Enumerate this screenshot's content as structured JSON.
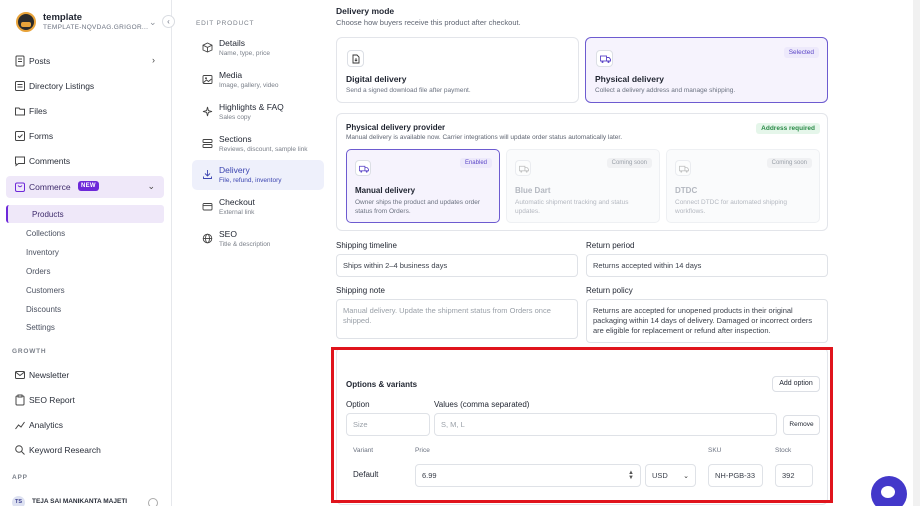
{
  "workspace": {
    "name": "template",
    "subtitle": "TEMPLATE-NQVDAG.GRIGOR..."
  },
  "sidebar": {
    "items": [
      {
        "label": "Posts"
      },
      {
        "label": "Directory Listings"
      },
      {
        "label": "Files"
      },
      {
        "label": "Forms"
      },
      {
        "label": "Comments"
      },
      {
        "label": "Commerce",
        "badge": "NEW"
      }
    ],
    "commerce_sub": [
      "Products",
      "Collections",
      "Inventory",
      "Orders",
      "Customers",
      "Discounts",
      "Settings"
    ],
    "growth_label": "GROWTH",
    "growth_items": [
      {
        "label": "Newsletter"
      },
      {
        "label": "SEO Report"
      },
      {
        "label": "Analytics"
      },
      {
        "label": "Keyword Research"
      }
    ],
    "app_label": "APP",
    "user": {
      "initials": "TS",
      "name": "TEJA SAI MANIKANTA MAJETI"
    }
  },
  "edit_product": {
    "heading": "EDIT PRODUCT",
    "items": [
      {
        "title": "Details",
        "sub": "Name, type, price"
      },
      {
        "title": "Media",
        "sub": "Image, gallery, video"
      },
      {
        "title": "Highlights & FAQ",
        "sub": "Sales copy"
      },
      {
        "title": "Sections",
        "sub": "Reviews, discount, sample link"
      },
      {
        "title": "Delivery",
        "sub": "File, refund, inventory"
      },
      {
        "title": "Checkout",
        "sub": "External link"
      },
      {
        "title": "SEO",
        "sub": "Title & description"
      }
    ]
  },
  "delivery": {
    "title": "Delivery mode",
    "subtitle": "Choose how buyers receive this product after checkout.",
    "digital": {
      "title": "Digital delivery",
      "sub": "Send a signed download file after payment."
    },
    "physical": {
      "title": "Physical delivery",
      "sub": "Collect a delivery address and manage shipping.",
      "tag": "Selected"
    },
    "provider": {
      "title": "Physical delivery provider",
      "sub": "Manual delivery is available now. Carrier integrations will update order status automatically later.",
      "tag": "Address required",
      "options": [
        {
          "name": "Manual delivery",
          "desc": "Owner ships the product and updates order status from Orders.",
          "tag": "Enabled"
        },
        {
          "name": "Blue Dart",
          "desc": "Automatic shipment tracking and status updates.",
          "tag": "Coming soon"
        },
        {
          "name": "DTDC",
          "desc": "Connect DTDC for automated shipping workflows.",
          "tag": "Coming soon"
        }
      ]
    },
    "shipping_timeline": {
      "label": "Shipping timeline",
      "value": "Ships within 2–4 business days"
    },
    "return_period": {
      "label": "Return period",
      "value": "Returns accepted within 14 days"
    },
    "shipping_note": {
      "label": "Shipping note",
      "placeholder": "Manual delivery. Update the shipment status from Orders once shipped."
    },
    "return_policy": {
      "label": "Return policy",
      "value": "Returns are accepted for unopened products in their original packaging within 14 days of delivery. Damaged or incorrect orders are eligible for replacement or refund after inspection."
    }
  },
  "options": {
    "title": "Options & variants",
    "add_label": "Add option",
    "option_label": "Option",
    "values_label": "Values (comma separated)",
    "option_placeholder": "Size",
    "values_placeholder": "S, M, L",
    "remove_label": "Remove",
    "headers": {
      "variant": "Variant",
      "price": "Price",
      "sku": "SKU",
      "stock": "Stock"
    },
    "row": {
      "variant": "Default",
      "price": "6.99",
      "currency": "USD",
      "sku": "NH-PGB-33",
      "stock": "392"
    }
  },
  "colors": {
    "accent": "#6d5bd0",
    "highlight": "#e0141c"
  }
}
